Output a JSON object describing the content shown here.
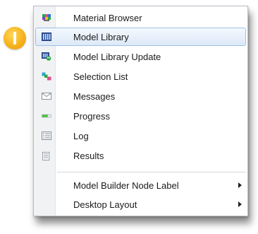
{
  "badge": {
    "color": "#f6b21c"
  },
  "menu": {
    "items": [
      {
        "label": "Material Browser",
        "icon": "material-browser-icon"
      },
      {
        "label": "Model Library",
        "icon": "model-library-icon",
        "highlighted": true
      },
      {
        "label": "Model Library Update",
        "icon": "model-library-update-icon"
      },
      {
        "label": "Selection List",
        "icon": "selection-list-icon"
      },
      {
        "label": "Messages",
        "icon": "envelope-icon"
      },
      {
        "label": "Progress",
        "icon": "progress-bar-icon"
      },
      {
        "label": "Log",
        "icon": "log-icon"
      },
      {
        "label": "Results",
        "icon": "results-icon"
      }
    ],
    "submenus": [
      {
        "label": "Model Builder Node Label",
        "icon": "submenu-arrow-icon"
      },
      {
        "label": "Desktop Layout",
        "icon": "submenu-arrow-icon"
      }
    ],
    "highlight_color": "#dde9f8"
  }
}
